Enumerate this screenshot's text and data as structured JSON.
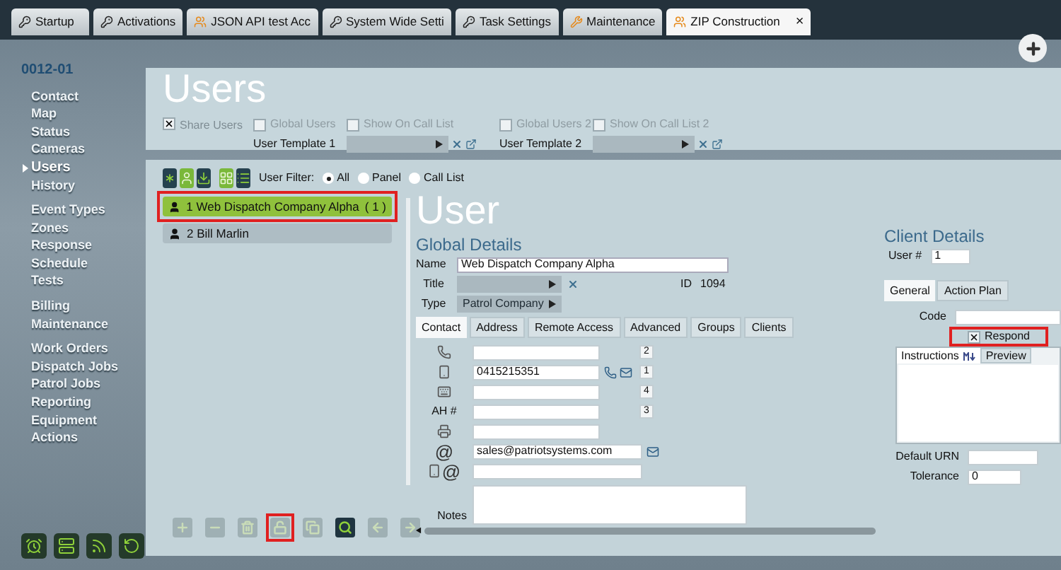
{
  "tabs": [
    {
      "label": "Startup",
      "kind": "key",
      "selected": false
    },
    {
      "label": "Activations",
      "kind": "key",
      "selected": false
    },
    {
      "label": "JSON API test Acc",
      "kind": "users",
      "selected": false
    },
    {
      "label": "System Wide Setti",
      "kind": "key",
      "selected": false
    },
    {
      "label": "Task Settings",
      "kind": "key",
      "selected": false
    },
    {
      "label": "Maintenance",
      "kind": "wrench",
      "selected": false
    },
    {
      "label": "ZIP Construction",
      "kind": "users",
      "selected": true,
      "close": "×"
    }
  ],
  "sidebar": {
    "account": "0012-01",
    "groups": [
      [
        {
          "label": "Contact",
          "selected": false
        },
        {
          "label": "Map",
          "selected": false
        },
        {
          "label": "Status",
          "selected": false
        },
        {
          "label": "Cameras",
          "selected": false
        },
        {
          "label": "Users",
          "selected": true
        },
        {
          "label": "History",
          "selected": false
        }
      ],
      [
        {
          "label": "Event Types",
          "selected": false
        },
        {
          "label": "Zones",
          "selected": false
        },
        {
          "label": "Response",
          "selected": false
        },
        {
          "label": "Schedule",
          "selected": false
        },
        {
          "label": "Tests",
          "selected": false
        }
      ],
      [
        {
          "label": "Billing",
          "selected": false
        },
        {
          "label": "Maintenance",
          "selected": false
        }
      ],
      [
        {
          "label": "Work Orders",
          "selected": false
        },
        {
          "label": "Dispatch Jobs",
          "selected": false
        },
        {
          "label": "Patrol Jobs",
          "selected": false
        },
        {
          "label": "Reporting",
          "selected": false
        },
        {
          "label": "Equipment",
          "selected": false
        },
        {
          "label": "Actions",
          "selected": false
        }
      ]
    ]
  },
  "header": {
    "title": "Users",
    "share": {
      "label": "Share Users",
      "checked": true
    },
    "groups": [
      {
        "options": [
          {
            "label": "Global Users",
            "checked": false
          },
          {
            "label": "Show On Call List",
            "checked": false
          }
        ],
        "template": "User Template 1"
      },
      {
        "options": [
          {
            "label": "Global Users 2",
            "checked": false
          },
          {
            "label": "Show On Call List 2",
            "checked": false
          }
        ],
        "template": "User Template 2"
      }
    ]
  },
  "filter": {
    "label": "User Filter:",
    "options": [
      {
        "label": "All",
        "selected": true
      },
      {
        "label": "Panel",
        "selected": false
      },
      {
        "label": "Call List",
        "selected": false
      }
    ]
  },
  "users": [
    {
      "label": "1 Web Dispatch Company Alpha",
      "count": "( 1 )",
      "selected": true,
      "highlighted": true
    },
    {
      "label": "2 Bill Marlin",
      "selected": false,
      "highlighted": false
    }
  ],
  "list_toolbar": [
    {
      "kind": "add",
      "disabled": true,
      "highlighted": false
    },
    {
      "kind": "remove",
      "disabled": true,
      "highlighted": false
    },
    {
      "kind": "delete",
      "disabled": true,
      "highlighted": false
    },
    {
      "kind": "unlock",
      "disabled": true,
      "highlighted": true
    },
    {
      "kind": "copy",
      "disabled": true,
      "highlighted": false
    },
    {
      "kind": "search",
      "disabled": false,
      "highlighted": false
    },
    {
      "kind": "previous",
      "disabled": true,
      "highlighted": false
    },
    {
      "kind": "next",
      "disabled": true,
      "highlighted": false
    }
  ],
  "detail": {
    "title": "User",
    "global": {
      "heading": "Global Details",
      "name_label": "Name",
      "name": "Web Dispatch Company Alpha",
      "title_label": "Title",
      "id_label": "ID",
      "id": "1094",
      "type_label": "Type",
      "type": "Patrol Company",
      "tabs": [
        {
          "label": "Contact",
          "selected": true
        },
        {
          "label": "Address",
          "selected": false
        },
        {
          "label": "Remote Access",
          "selected": false
        },
        {
          "label": "Advanced",
          "selected": false
        },
        {
          "label": "Groups",
          "selected": false
        },
        {
          "label": "Clients",
          "selected": false
        }
      ],
      "contacts": [
        {
          "kind": "phone",
          "priority": "2"
        },
        {
          "kind": "mobile",
          "value": "0415215351",
          "call": true,
          "mail": true,
          "priority": "1"
        },
        {
          "kind": "pager",
          "priority": "4"
        },
        {
          "kind": "label",
          "label": "AH #",
          "priority": "3"
        },
        {
          "kind": "fax"
        },
        {
          "kind": "email",
          "label": "@",
          "value": "sales@patriotsystems.com",
          "call": false,
          "mail": true
        },
        {
          "kind": "sms-email",
          "label": "@"
        }
      ],
      "notes_label": "Notes"
    },
    "client": {
      "heading": "Client Details",
      "user_label": "User #",
      "user_number": "1",
      "tabs": [
        {
          "label": "General",
          "selected": true
        },
        {
          "label": "Action Plan",
          "selected": false
        }
      ],
      "code_label": "Code",
      "respond": {
        "label": "Respond",
        "checked": true,
        "highlighted": true
      },
      "editor_tabs": [
        {
          "label": "Instructions",
          "selected": true,
          "markdown": true
        },
        {
          "label": "Preview",
          "selected": false
        }
      ],
      "urn_label": "Default URN",
      "tolerance_label": "Tolerance",
      "tolerance": "0"
    }
  }
}
